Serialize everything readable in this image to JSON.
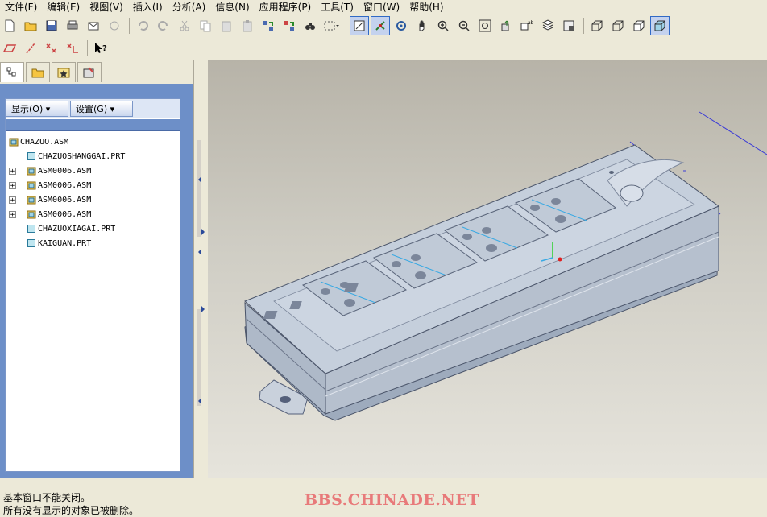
{
  "menu": [
    "文件(F)",
    "编辑(E)",
    "视图(V)",
    "插入(I)",
    "分析(A)",
    "信息(N)",
    "应用程序(P)",
    "工具(T)",
    "窗口(W)",
    "帮助(H)"
  ],
  "nav": {
    "show_button": "显示(O) ▾",
    "settings_button": "设置(G) ▾",
    "tree": [
      {
        "label": "CHAZUO.ASM",
        "level": 0,
        "kind": "asm",
        "expandable": false
      },
      {
        "label": "CHAZUOSHANGGAI.PRT",
        "level": 1,
        "kind": "prt",
        "expandable": false
      },
      {
        "label": "ASM0006.ASM",
        "level": 1,
        "kind": "asm",
        "expandable": true
      },
      {
        "label": "ASM0006.ASM",
        "level": 1,
        "kind": "asm",
        "expandable": true
      },
      {
        "label": "ASM0006.ASM",
        "level": 1,
        "kind": "asm",
        "expandable": true
      },
      {
        "label": "ASM0006.ASM",
        "level": 1,
        "kind": "asm",
        "expandable": true
      },
      {
        "label": "CHAZUOXIAGAI.PRT",
        "level": 1,
        "kind": "prt",
        "expandable": false
      },
      {
        "label": "KAIGUAN.PRT",
        "level": 1,
        "kind": "prt",
        "expandable": false
      }
    ]
  },
  "status": {
    "line1": "基本窗口不能关闭。",
    "line2": "所有没有显示的对象已被删除。"
  },
  "watermark": "BBS.CHINADE.NET",
  "colors": {
    "nav_panel": "#6d8fc8",
    "model_top": "#c5cfdc",
    "model_side": "#9eabbd",
    "watermark": "#e87a7a"
  }
}
